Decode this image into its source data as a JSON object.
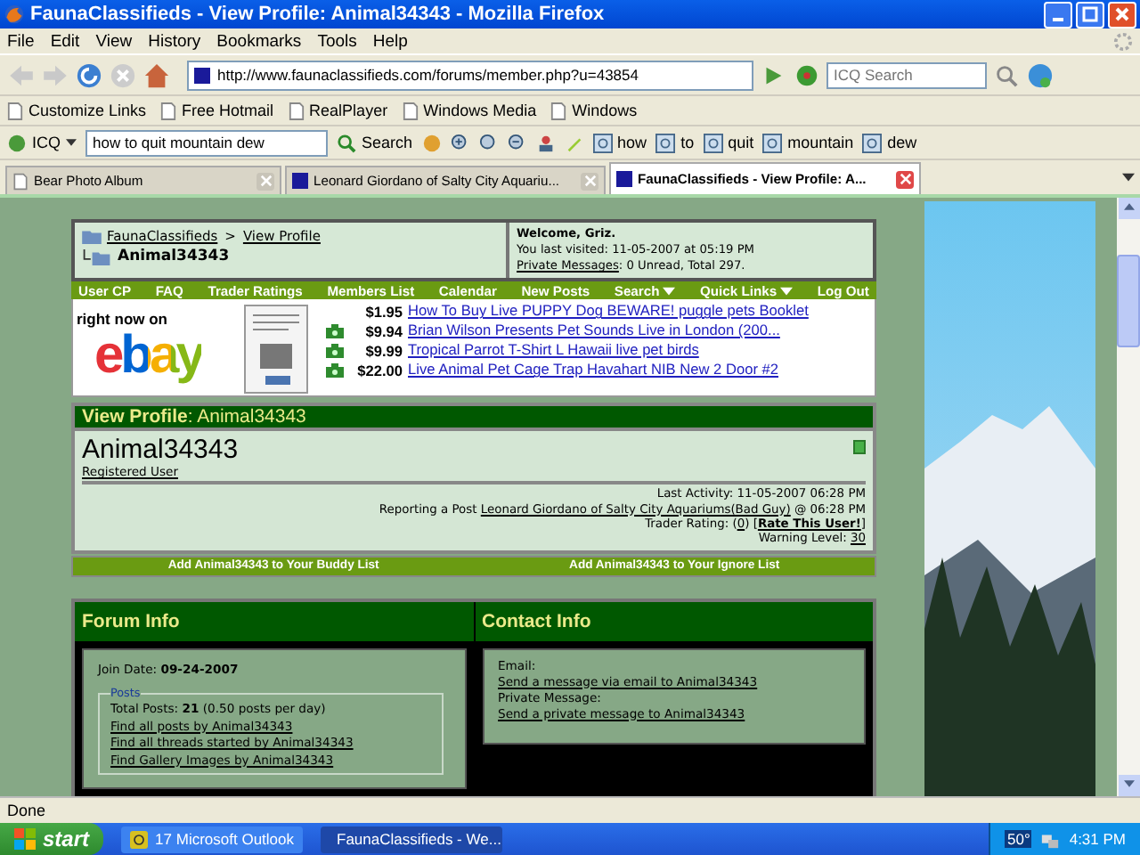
{
  "window": {
    "title": "FaunaClassifieds - View Profile: Animal34343 - Mozilla Firefox"
  },
  "menu": [
    "File",
    "Edit",
    "View",
    "History",
    "Bookmarks",
    "Tools",
    "Help"
  ],
  "navigation": {
    "url": "http://www.faunaclassifieds.com/forums/member.php?u=43854",
    "search_placeholder": "ICQ Search"
  },
  "bookmarks": [
    "Customize Links",
    "Free Hotmail",
    "RealPlayer",
    "Windows Media",
    "Windows"
  ],
  "icq_toolbar": {
    "label": "ICQ",
    "query": "how to quit mountain dew",
    "search_label": "Search",
    "words": [
      "how",
      "to",
      "quit",
      "mountain",
      "dew"
    ]
  },
  "tabs": [
    {
      "label": "Bear Photo Album",
      "kind": "page",
      "selected": false
    },
    {
      "label": "Leonard Giordano of Salty City Aquariu...",
      "kind": "site",
      "selected": false
    },
    {
      "label": "FaunaClassifieds - View Profile: A...",
      "kind": "site",
      "selected": true
    }
  ],
  "page": {
    "breadcrumb": {
      "root": "FaunaClassifieds",
      "separator": ">",
      "section": "View Profile",
      "current": "Animal34343"
    },
    "welcome": {
      "greeting": "Welcome, Griz.",
      "last_visited": "You last visited: 11-05-2007 at 05:19 PM",
      "pm_link": "Private Messages",
      "pm_text": ": 0 Unread, Total 297."
    },
    "navbar": [
      {
        "label": "User CP",
        "dropdown": false
      },
      {
        "label": "FAQ",
        "dropdown": false
      },
      {
        "label": "Trader Ratings",
        "dropdown": false
      },
      {
        "label": "Members List",
        "dropdown": false
      },
      {
        "label": "Calendar",
        "dropdown": false
      },
      {
        "label": "New Posts",
        "dropdown": false
      },
      {
        "label": "Search",
        "dropdown": true
      },
      {
        "label": "Quick Links",
        "dropdown": true
      },
      {
        "label": "Log Out",
        "dropdown": false
      }
    ],
    "ebay": {
      "tagline": "right now on",
      "logo": "ebay",
      "listings": [
        {
          "price": "$1.95",
          "title": "How To Buy Live PUPPY Dog BEWARE! puggle pets Booklet",
          "has_icon": false
        },
        {
          "price": "$9.94",
          "title": "Brian Wilson Presents Pet Sounds Live in London (200...",
          "has_icon": true
        },
        {
          "price": "$9.99",
          "title": "Tropical Parrot T-Shirt L Hawaii live pet birds",
          "has_icon": true
        },
        {
          "price": "$22.00",
          "title": "Live Animal Pet Cage Trap Havahart NIB New 2 Door #2",
          "has_icon": true
        }
      ]
    },
    "profile": {
      "heading": "**View Profile**: Animal34343",
      "name": "Animal34343",
      "user_title": "Registered User",
      "online": true,
      "last_activity": "Last Activity: 11-05-2007 06:28 PM",
      "reporting": {
        "prefix": "Reporting a Post ",
        "link": "Leonard Giordano of Salty City Aquariums(Bad Guy)",
        "suffix": " @ 06:28 PM"
      },
      "trader_rating": {
        "prefix": "Trader Rating: (",
        "link": "0",
        "middle": ") [",
        "rate_link": "Rate This User!",
        "suffix": "]"
      },
      "warning": {
        "prefix": "Warning Level: ",
        "link": "30"
      }
    },
    "actions": [
      "Add Animal34343 to Your Buddy List",
      "Add Animal34343 to Your Ignore List"
    ],
    "forum_info": {
      "title": "Forum Info",
      "join_date": "Join Date: **09-24-2007**",
      "posts_legend": "Posts",
      "total_posts": "Total Posts: **21** (0.50 posts per day)",
      "links": [
        "Find all posts by Animal34343",
        "Find all threads started by Animal34343",
        "Find Gallery Images by Animal34343"
      ]
    },
    "contact_info": {
      "title": "Contact Info",
      "items": [
        {
          "label": "Email:",
          "link": "Send a message via email to Animal34343"
        },
        {
          "label": "Private Message:",
          "link": "Send a private message to Animal34343"
        }
      ]
    }
  },
  "status_bar": {
    "text": "Done"
  },
  "taskbar": {
    "start": "start",
    "tasks": [
      {
        "label": "17 Microsoft Outlook",
        "kind": "mail",
        "selected": false
      },
      {
        "label": "FaunaClassifieds - We...",
        "kind": "browser",
        "selected": true
      }
    ],
    "temperature": "50°",
    "time": "4:31 PM"
  }
}
